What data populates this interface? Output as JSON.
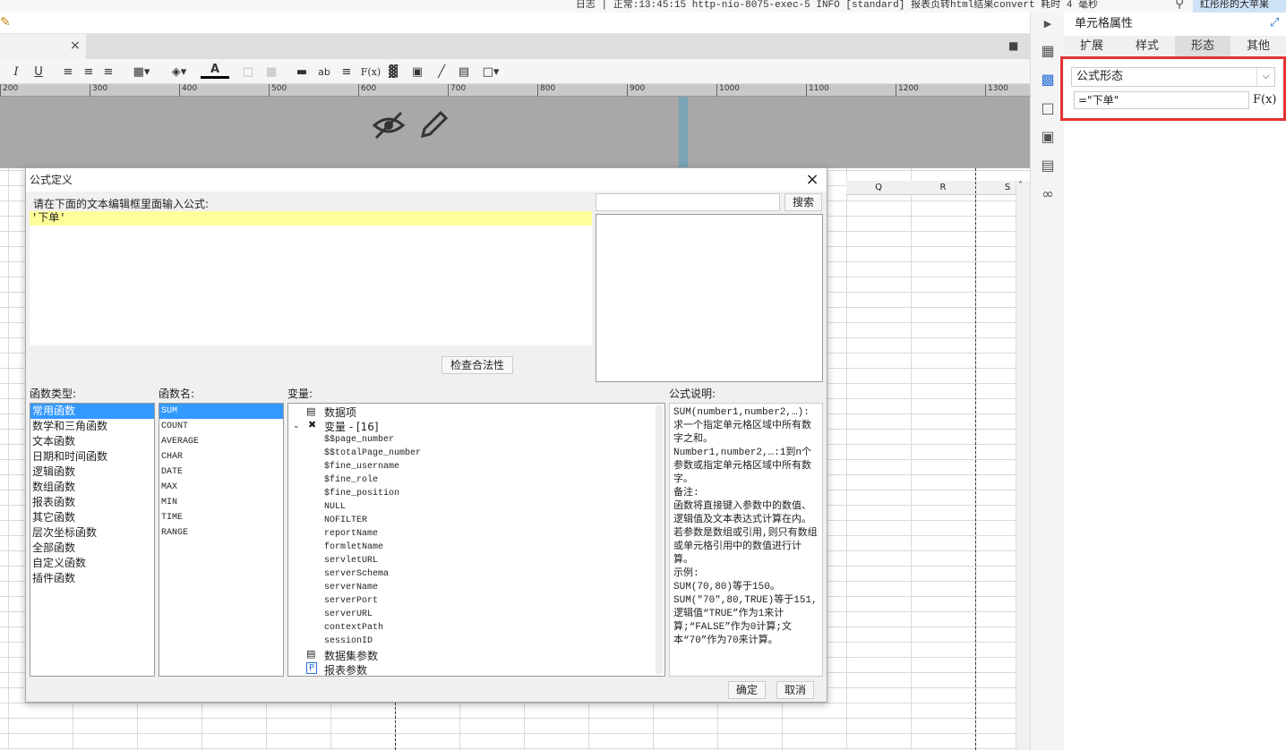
{
  "topbar": {
    "log": "日志 | 正常:13:45:15 http-nio-8075-exec-5 INFO [standard] 报表页转html结果convert 耗时 4 毫秒",
    "template_name": "红彤彤的大苹果"
  },
  "toolbar": {
    "italic": "I",
    "underline": "U",
    "font_color": "A",
    "abc": "ab",
    "fx": "F(x)"
  },
  "ruler": [
    "200",
    "300",
    "400",
    "500",
    "600",
    "700",
    "800",
    "900",
    "1000",
    "1100",
    "1200",
    "1300"
  ],
  "columns": [
    "Q",
    "R",
    "S"
  ],
  "panel": {
    "title": "单元格属性",
    "tabs": [
      "扩展",
      "样式",
      "形态",
      "其他"
    ],
    "active_tab": "形态",
    "form_type": "公式形态",
    "formula": "=\"下单\"",
    "fx": "F(x)"
  },
  "dialog": {
    "title": "公式定义",
    "prompt": "请在下面的文本编辑框里面输入公式:",
    "formula": "'下单'",
    "search_btn": "搜索",
    "check_btn": "检查合法性",
    "func_type_label": "函数类型:",
    "func_name_label": "函数名:",
    "var_label": "变量:",
    "desc_label": "公式说明:",
    "func_types": [
      "常用函数",
      "数学和三角函数",
      "文本函数",
      "日期和时间函数",
      "逻辑函数",
      "数组函数",
      "报表函数",
      "其它函数",
      "层次坐标函数",
      "全部函数",
      "自定义函数",
      "插件函数"
    ],
    "func_names": [
      "SUM",
      "COUNT",
      "AVERAGE",
      "CHAR",
      "DATE",
      "MAX",
      "MIN",
      "TIME",
      "RANGE"
    ],
    "var_data_item": "数据项",
    "var_group": "变量 - [16]",
    "variables": [
      "$$page_number",
      "$$totalPage_number",
      "$fine_username",
      "$fine_role",
      "$fine_position",
      "NULL",
      "NOFILTER",
      "reportName",
      "formletName",
      "servletURL",
      "serverSchema",
      "serverName",
      "serverPort",
      "serverURL",
      "contextPath",
      "sessionID"
    ],
    "var_dataset": "数据集参数",
    "var_report": "报表参数",
    "description": "SUM(number1,number2,…):求一个指定单元格区域中所有数字之和。\nNumber1,number2,…:1到n个参数或指定单元格区域中所有数字。\n备注:\n函数将直接键入参数中的数值、逻辑值及文本表达式计算在内。若参数是数组或引用,则只有数组或单元格引用中的数值进行计算。\n示例:\nSUM(70,80)等于150。\nSUM(\"70\",80,TRUE)等于151,逻辑值“TRUE”作为1来计算;“FALSE”作为0计算;文本“70”作为70来计算。",
    "ok": "确定",
    "cancel": "取消"
  }
}
